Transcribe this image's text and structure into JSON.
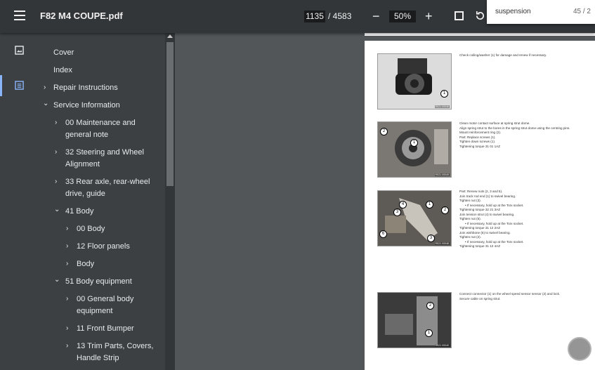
{
  "header": {
    "menu_icon": "hamburger-icon",
    "title": "F82 M4 COUPE.pdf",
    "current_page": "1135",
    "total_pages": "/ 4583",
    "zoom_out": "−",
    "zoom": "50%",
    "zoom_in": "+",
    "fit_icon": "fit-page-icon",
    "rotate_icon": "rotate-icon"
  },
  "search": {
    "query": "suspension",
    "count": "45 / 2"
  },
  "rail": {
    "thumbnails_icon": "image-icon",
    "outline_icon": "outline-icon"
  },
  "outline": {
    "cover": "Cover",
    "index": "Index",
    "repair": "Repair Instructions",
    "service": "Service Information",
    "s00_a": "00 Maintenance and",
    "s00_b": "general note",
    "s32_a": "32 Steering and Wheel",
    "s32_b": "Alignment",
    "s33_a": "33 Rear axle, rear-wheel",
    "s33_b": "drive, guide",
    "s41": "41 Body",
    "s41_00": "00 Body",
    "s41_12": "12 Floor panels",
    "s41_body": "Body",
    "s51": "51 Body equipment",
    "s51_00_a": "00 General body",
    "s51_00_b": "equipment",
    "s51_11": "11 Front Bumper",
    "s51_13_a": "13 Trim Parts, Covers,",
    "s51_13_b": "Handle Strip"
  },
  "page": {
    "p1": "Check coiling/washer (1) for damage and renew if necessary.",
    "p2": [
      "Clean motor contact surface at spring strut dome.",
      "Align spring strut to the bores in the spring strut dome using the centring pins.",
      "Mount reinforcement ring (2).",
      "Part: Replace screws (1).",
      "Tighten down screws (1).",
      "Tightening torque 31 01 1AZ"
    ],
    "p3": [
      "Part: Renew nuts (2, 3 and 5).",
      "Join track rod end (1) to swivel bearing.",
      "Tighten nut (3).",
      "If necessary, hold up at the Torx socket.",
      "Tightening torque 32 21 3AZ",
      "Join tension strut (4) to swivel bearing.",
      "Tighten nut (5).",
      "If necessary, hold up at the Torx socket.",
      "Tightening torque 31 12 2AZ",
      "Join wishbone (6) to swivel bearing.",
      "Tighten nut (2).",
      "If necessary, hold up at the Torx socket.",
      "Tightening torque 31 12 4AZ"
    ],
    "p4": [
      "Connect connector (1) on the wheel speed sensor sensor (2) and lock.",
      "Secure cable on spring strut."
    ],
    "img_ids": [
      "RS21 00046",
      "RS21 00049",
      "RS21 00048",
      "RS21 00040"
    ]
  }
}
